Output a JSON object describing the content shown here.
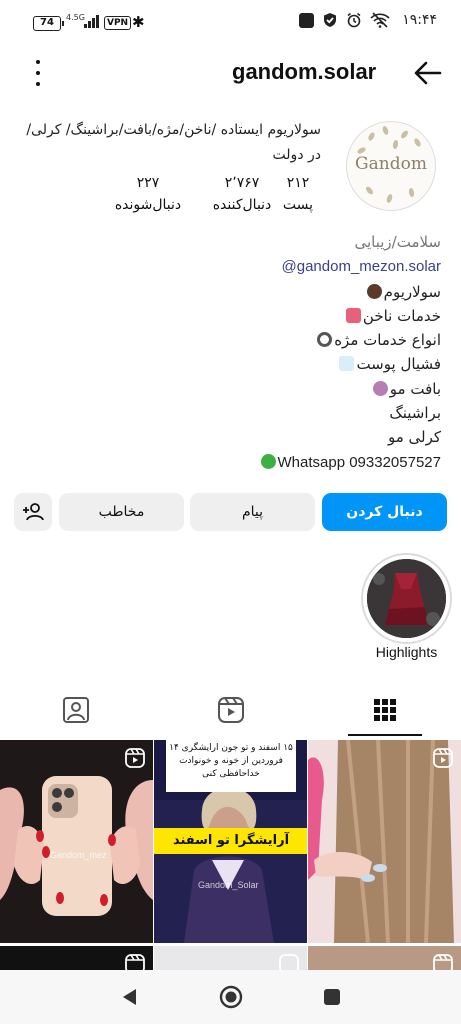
{
  "status_bar": {
    "battery": "74",
    "network": "4.5G",
    "vpn": "VPN",
    "time": "۱۹:۴۴"
  },
  "header": {
    "username": "gandom.solar"
  },
  "profile": {
    "bio_top": "سولاریوم ایستاده /ناخن/مژه/بافت/براشینگ/ کرلی/ در دولت",
    "avatar_text": "Gandom",
    "stats": {
      "posts": {
        "value": "۲۱۲",
        "label": "پست"
      },
      "followers": {
        "value": "۲٬۷۶۷",
        "label": "دنبال‌کننده"
      },
      "following": {
        "value": "۲۲۷",
        "label": "دنبال‌شونده"
      }
    },
    "category": "سلامت/زیبایی",
    "link": "@gandom_mezon.solar",
    "bio_lines": [
      "سولاریوم",
      "خدمات ناخن",
      "انواع خدمات مژه",
      "فشیال پوست",
      "بافت مو",
      "براشینگ",
      "کرلی مو",
      "Whatsapp 09332057527"
    ]
  },
  "actions": {
    "follow": "دنبال کردن",
    "message": "پیام",
    "contact": "مخاطب"
  },
  "highlights": [
    {
      "label": "Highlights"
    }
  ],
  "tabs": {
    "active": "grid"
  },
  "posts": {
    "center_top_text": "۱۵ اسفند و تو جون ارایشگری ۱۴ فروردین از خونه و خونوادت خداحافظی کنی",
    "center_banner": "آرایشگرا تو اسفند",
    "watermark_1": "Gandom_mez",
    "watermark_2": "Gandom_Solar"
  },
  "colors": {
    "accent": "#0095f6",
    "link": "#3b3f8f"
  }
}
